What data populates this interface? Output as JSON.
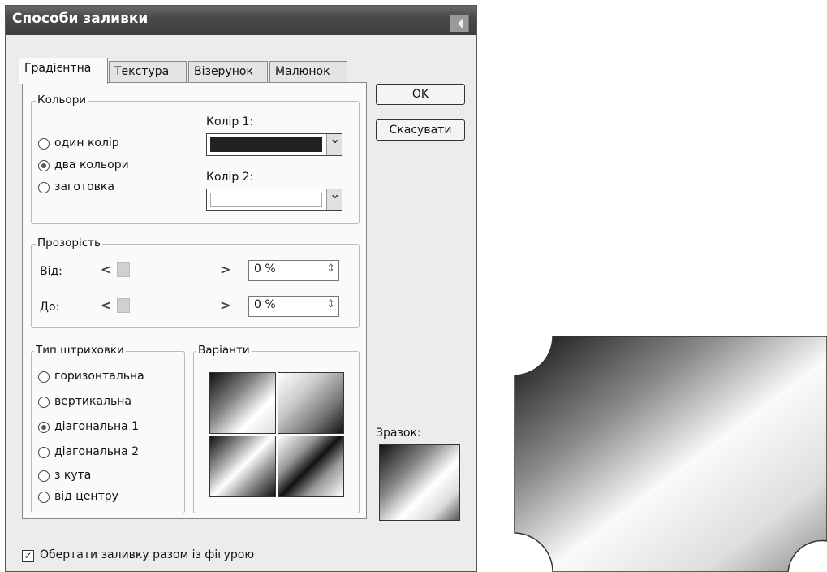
{
  "dialog": {
    "title": "Способи заливки",
    "tabs": [
      "Градієнтна",
      "Текстура",
      "Візерунок",
      "Малюнок"
    ],
    "active_tab": "Градієнтна",
    "buttons": {
      "ok": "OK",
      "cancel": "Скасувати"
    }
  },
  "colors_group": {
    "label": "Кольори",
    "options": [
      "один колір",
      "два кольори",
      "заготовка"
    ],
    "selected": "два кольори",
    "color1_label": "Колір 1:",
    "color1_value": "#222222",
    "color2_label": "Колір 2:",
    "color2_value": "#ffffff"
  },
  "transparency_group": {
    "label": "Прозорість",
    "from_label": "Від:",
    "from_value": "0 %",
    "to_label": "До:",
    "to_value": "0 %"
  },
  "shading_group": {
    "label": "Тип штриховки",
    "options": [
      "горизонтальна",
      "вертикальна",
      "діагональна 1",
      "діагональна 2",
      "з кута",
      "від центру"
    ],
    "selected": "діагональна 1"
  },
  "variants": {
    "label": "Варіанти"
  },
  "sample": {
    "label": "Зразок:"
  },
  "rotate_checkbox": {
    "label": "Обертати заливку разом із фігурою",
    "checked": true
  }
}
